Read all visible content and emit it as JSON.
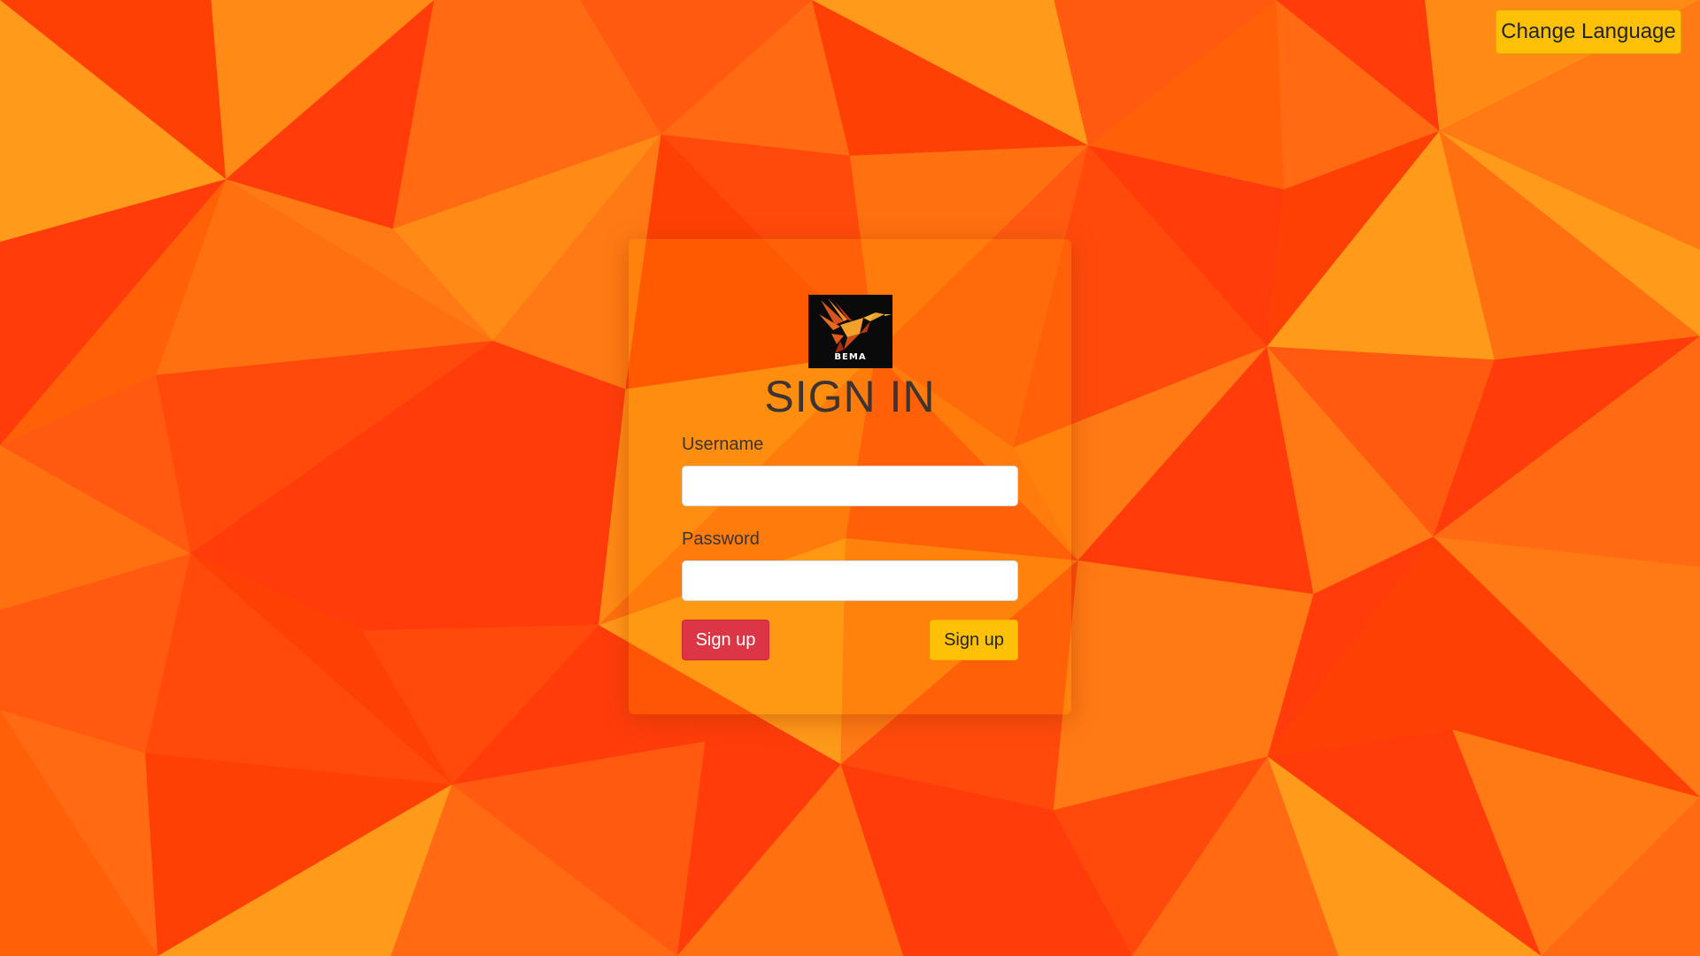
{
  "header": {
    "change_language_label": "Change Language"
  },
  "login": {
    "logo_text": "BEMA",
    "title": "SIGN IN",
    "username_label": "Username",
    "username_value": "",
    "password_label": "Password",
    "password_value": "",
    "primary_button_label": "Sign up",
    "secondary_button_label": "Sign up"
  },
  "colors": {
    "background": "#ff5a0a",
    "language_button": "#ffc107",
    "danger_button": "#dc3545",
    "warning_button": "#ffc107",
    "text": "#3b3430"
  },
  "icons": {
    "logo": "hummingbird-logo-icon"
  }
}
